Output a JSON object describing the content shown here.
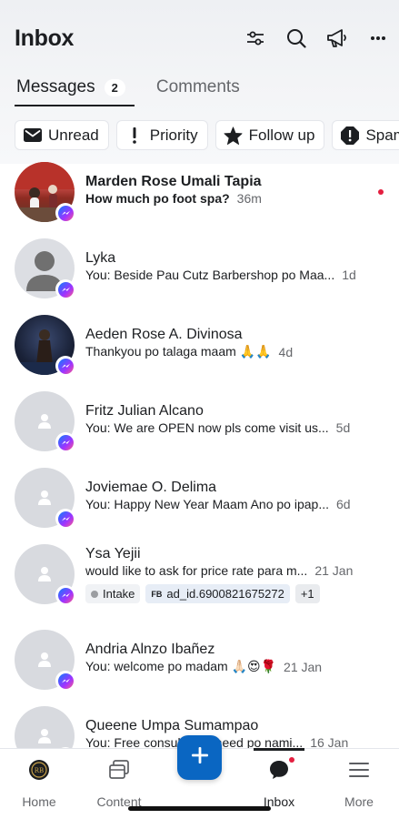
{
  "header": {
    "title": "Inbox",
    "icons": [
      "filter-sliders-icon",
      "search-icon",
      "megaphone-icon",
      "more-icon"
    ]
  },
  "tabs": [
    {
      "label": "Messages",
      "count": "2",
      "active": true
    },
    {
      "label": "Comments",
      "active": false
    }
  ],
  "filters": [
    {
      "label": "Unread",
      "icon": "envelope-icon"
    },
    {
      "label": "Priority",
      "icon": "exclamation-icon"
    },
    {
      "label": "Follow up",
      "icon": "star-icon"
    },
    {
      "label": "Spam",
      "icon": "spam-alert-icon"
    }
  ],
  "conversations": [
    {
      "name": "Marden Rose Umali Tapia",
      "preview": "How much po foot spa?",
      "time": "36m",
      "unread": true
    },
    {
      "name": "Lyka",
      "preview": "You: Beside Pau Cutz Barbershop po Maa...",
      "time": "1d"
    },
    {
      "name": "Aeden Rose A. Divinosa",
      "preview": "Thankyou po talaga maam 🙏🙏",
      "time": "4d"
    },
    {
      "name": "Fritz Julian Alcano",
      "preview": "You: We are OPEN now pls come visit us...",
      "time": "5d"
    },
    {
      "name": "Joviemae O. Delima",
      "preview": "You: Happy New Year Maam Ano po ipap...",
      "time": "6d"
    },
    {
      "name": "Ysa Yejii",
      "preview": "would like to ask for price rate para m...",
      "time": "21 Jan",
      "tags": {
        "label_tag": "Intake",
        "ad_prefix": "FB",
        "ad_tag": "ad_id.6900821675272",
        "more": "+1"
      }
    },
    {
      "name": "Andria Alnzo Ibañez",
      "preview": "You: welcome po madam 🙏🏻😍🌹",
      "time": "21 Jan"
    },
    {
      "name": "Queene Umpa Sumampao",
      "preview": "You: Free consultation need po nami...",
      "time": "16 Jan"
    }
  ],
  "nav": {
    "home": "Home",
    "content": "Content",
    "create_icon": "plus-icon",
    "inbox": "Inbox",
    "more": "More"
  },
  "colors": {
    "accent": "#0a66c2",
    "unread_dot": "#e41e3f",
    "text": "#1c1e21",
    "secondary": "#65676b"
  }
}
